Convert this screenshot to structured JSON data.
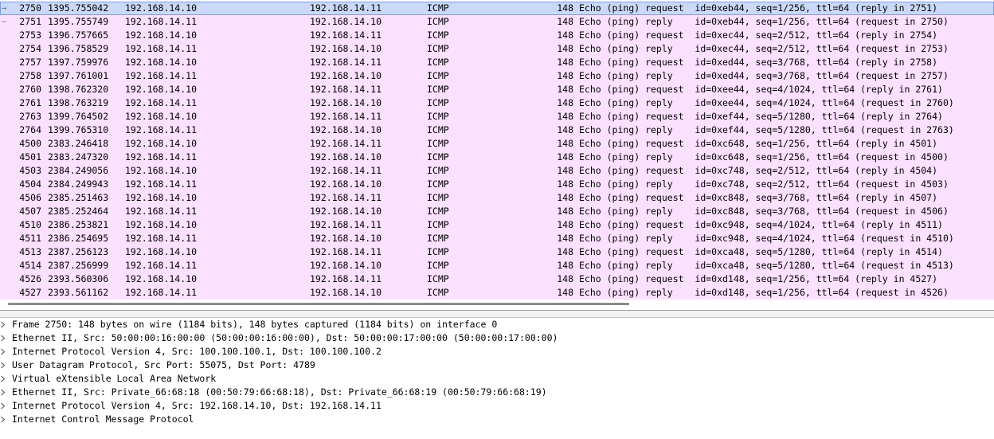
{
  "packets": [
    {
      "no": "2750",
      "time": "1395.755042",
      "src": "192.168.14.10",
      "dst": "192.168.14.11",
      "proto": "ICMP",
      "len": "148",
      "info": "Echo (ping) request  id=0xeb44, seq=1/256, ttl=64 (reply in 2751)",
      "mark": "→",
      "selected": true
    },
    {
      "no": "2751",
      "time": "1395.755749",
      "src": "192.168.14.11",
      "dst": "192.168.14.10",
      "proto": "ICMP",
      "len": "148",
      "info": "Echo (ping) reply    id=0xeb44, seq=1/256, ttl=64 (request in 2750)",
      "mark": "–"
    },
    {
      "no": "2753",
      "time": "1396.757665",
      "src": "192.168.14.10",
      "dst": "192.168.14.11",
      "proto": "ICMP",
      "len": "148",
      "info": "Echo (ping) request  id=0xec44, seq=2/512, ttl=64 (reply in 2754)"
    },
    {
      "no": "2754",
      "time": "1396.758529",
      "src": "192.168.14.11",
      "dst": "192.168.14.10",
      "proto": "ICMP",
      "len": "148",
      "info": "Echo (ping) reply    id=0xec44, seq=2/512, ttl=64 (request in 2753)"
    },
    {
      "no": "2757",
      "time": "1397.759976",
      "src": "192.168.14.10",
      "dst": "192.168.14.11",
      "proto": "ICMP",
      "len": "148",
      "info": "Echo (ping) request  id=0xed44, seq=3/768, ttl=64 (reply in 2758)"
    },
    {
      "no": "2758",
      "time": "1397.761001",
      "src": "192.168.14.11",
      "dst": "192.168.14.10",
      "proto": "ICMP",
      "len": "148",
      "info": "Echo (ping) reply    id=0xed44, seq=3/768, ttl=64 (request in 2757)"
    },
    {
      "no": "2760",
      "time": "1398.762320",
      "src": "192.168.14.10",
      "dst": "192.168.14.11",
      "proto": "ICMP",
      "len": "148",
      "info": "Echo (ping) request  id=0xee44, seq=4/1024, ttl=64 (reply in 2761)"
    },
    {
      "no": "2761",
      "time": "1398.763219",
      "src": "192.168.14.11",
      "dst": "192.168.14.10",
      "proto": "ICMP",
      "len": "148",
      "info": "Echo (ping) reply    id=0xee44, seq=4/1024, ttl=64 (request in 2760)"
    },
    {
      "no": "2763",
      "time": "1399.764502",
      "src": "192.168.14.10",
      "dst": "192.168.14.11",
      "proto": "ICMP",
      "len": "148",
      "info": "Echo (ping) request  id=0xef44, seq=5/1280, ttl=64 (reply in 2764)"
    },
    {
      "no": "2764",
      "time": "1399.765310",
      "src": "192.168.14.11",
      "dst": "192.168.14.10",
      "proto": "ICMP",
      "len": "148",
      "info": "Echo (ping) reply    id=0xef44, seq=5/1280, ttl=64 (request in 2763)"
    },
    {
      "no": "4500",
      "time": "2383.246418",
      "src": "192.168.14.10",
      "dst": "192.168.14.11",
      "proto": "ICMP",
      "len": "148",
      "info": "Echo (ping) request  id=0xc648, seq=1/256, ttl=64 (reply in 4501)"
    },
    {
      "no": "4501",
      "time": "2383.247320",
      "src": "192.168.14.11",
      "dst": "192.168.14.10",
      "proto": "ICMP",
      "len": "148",
      "info": "Echo (ping) reply    id=0xc648, seq=1/256, ttl=64 (request in 4500)"
    },
    {
      "no": "4503",
      "time": "2384.249056",
      "src": "192.168.14.10",
      "dst": "192.168.14.11",
      "proto": "ICMP",
      "len": "148",
      "info": "Echo (ping) request  id=0xc748, seq=2/512, ttl=64 (reply in 4504)"
    },
    {
      "no": "4504",
      "time": "2384.249943",
      "src": "192.168.14.11",
      "dst": "192.168.14.10",
      "proto": "ICMP",
      "len": "148",
      "info": "Echo (ping) reply    id=0xc748, seq=2/512, ttl=64 (request in 4503)"
    },
    {
      "no": "4506",
      "time": "2385.251463",
      "src": "192.168.14.10",
      "dst": "192.168.14.11",
      "proto": "ICMP",
      "len": "148",
      "info": "Echo (ping) request  id=0xc848, seq=3/768, ttl=64 (reply in 4507)"
    },
    {
      "no": "4507",
      "time": "2385.252464",
      "src": "192.168.14.11",
      "dst": "192.168.14.10",
      "proto": "ICMP",
      "len": "148",
      "info": "Echo (ping) reply    id=0xc848, seq=3/768, ttl=64 (request in 4506)"
    },
    {
      "no": "4510",
      "time": "2386.253821",
      "src": "192.168.14.10",
      "dst": "192.168.14.11",
      "proto": "ICMP",
      "len": "148",
      "info": "Echo (ping) request  id=0xc948, seq=4/1024, ttl=64 (reply in 4511)"
    },
    {
      "no": "4511",
      "time": "2386.254695",
      "src": "192.168.14.11",
      "dst": "192.168.14.10",
      "proto": "ICMP",
      "len": "148",
      "info": "Echo (ping) reply    id=0xc948, seq=4/1024, ttl=64 (request in 4510)"
    },
    {
      "no": "4513",
      "time": "2387.256123",
      "src": "192.168.14.10",
      "dst": "192.168.14.11",
      "proto": "ICMP",
      "len": "148",
      "info": "Echo (ping) request  id=0xca48, seq=5/1280, ttl=64 (reply in 4514)"
    },
    {
      "no": "4514",
      "time": "2387.256999",
      "src": "192.168.14.11",
      "dst": "192.168.14.10",
      "proto": "ICMP",
      "len": "148",
      "info": "Echo (ping) reply    id=0xca48, seq=5/1280, ttl=64 (request in 4513)"
    },
    {
      "no": "4526",
      "time": "2393.560306",
      "src": "192.168.14.10",
      "dst": "192.168.14.11",
      "proto": "ICMP",
      "len": "148",
      "info": "Echo (ping) request  id=0xd148, seq=1/256, ttl=64 (reply in 4527)"
    },
    {
      "no": "4527",
      "time": "2393.561162",
      "src": "192.168.14.11",
      "dst": "192.168.14.10",
      "proto": "ICMP",
      "len": "148",
      "info": "Echo (ping) reply    id=0xd148, seq=1/256, ttl=64 (request in 4526)"
    }
  ],
  "details": [
    "Frame 2750: 148 bytes on wire (1184 bits), 148 bytes captured (1184 bits) on interface 0",
    "Ethernet II, Src: 50:00:00:16:00:00 (50:00:00:16:00:00), Dst: 50:00:00:17:00:00 (50:00:00:17:00:00)",
    "Internet Protocol Version 4, Src: 100.100.100.1, Dst: 100.100.100.2",
    "User Datagram Protocol, Src Port: 55075, Dst Port: 4789",
    "Virtual eXtensible Local Area Network",
    "Ethernet II, Src: Private_66:68:18 (00:50:79:66:68:18), Dst: Private_66:68:19 (00:50:79:66:68:19)",
    "Internet Protocol Version 4, Src: 192.168.14.10, Dst: 192.168.14.11",
    "Internet Control Message Protocol"
  ],
  "colors": {
    "row_bg": "#fce0ff",
    "selected_bg": "#cad9f7",
    "selected_border": "#7c9ce4"
  },
  "icons": {
    "expand": "chevron-right-icon",
    "related_request": "arrow-right-icon",
    "related_reply": "dash-icon"
  }
}
